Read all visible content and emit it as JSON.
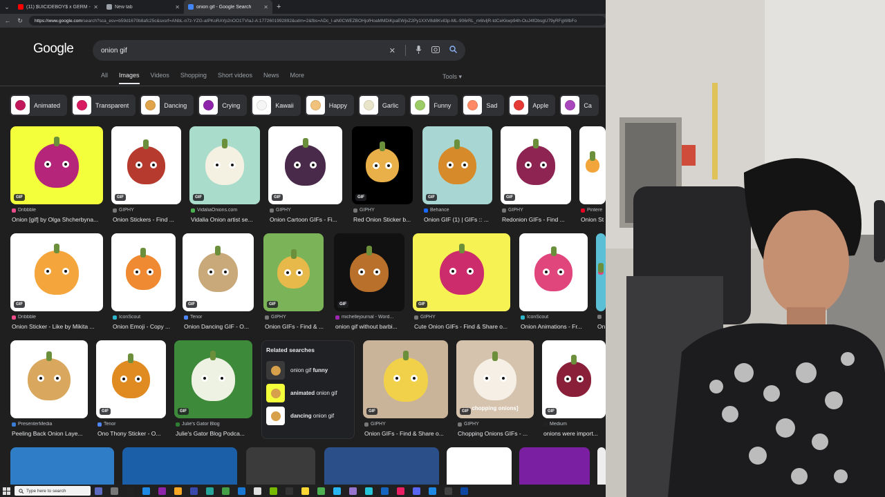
{
  "browser": {
    "tabs": [
      {
        "label": "(11) $UICIDEBOY$ x GERM - CENT",
        "favicon_color": "#ff0000",
        "active": false
      },
      {
        "label": "New tab",
        "favicon_color": "#9aa0a6",
        "active": false
      },
      {
        "label": "onion gif - Google Search",
        "favicon_color": "#4285f4",
        "active": true
      }
    ],
    "url_host": "https://www.google.com",
    "url_rest": "/search?sca_esv=b59d1670b8afc25c&sxsrf=ANbL-n7z-YZG-aIPKoRAYp2nOO1TVIaJ-A:1772601992892&udm=2&fbs=ADc_l-aN0CWEZBOHjofHoaMMDiKpaEWjvZ2Py1XXV8d8Kvil3p-ML-906rRL_m6lvljR-tdCeKkwp94h-OuJ4fObsgU79yRFgWlbFo"
  },
  "google": {
    "logo": "Google",
    "query": "onion gif",
    "tabs": [
      "All",
      "Images",
      "Videos",
      "Shopping",
      "Short videos",
      "News",
      "More"
    ],
    "active_tab": "Images",
    "tools": "Tools"
  },
  "chips": [
    {
      "label": "Animated",
      "color": "#c2185b"
    },
    {
      "label": "Transparent",
      "color": "#d81b60"
    },
    {
      "label": "Dancing",
      "color": "#e0a44a"
    },
    {
      "label": "Crying",
      "color": "#8e24aa"
    },
    {
      "label": "Kawaii",
      "color": "#f5f5f5"
    },
    {
      "label": "Happy",
      "color": "#f0c27b"
    },
    {
      "label": "Garlic",
      "color": "#e8e4c9"
    },
    {
      "label": "Funny",
      "color": "#9ccc65"
    },
    {
      "label": "Sad",
      "color": "#ff8a65"
    },
    {
      "label": "Apple",
      "color": "#e53935"
    },
    {
      "label": "Ca",
      "color": "#ab47bc"
    }
  ],
  "results": [
    {
      "source": "Dribbble",
      "title": "Onion [gif] by Olga Shcherbyna...",
      "gif": "GIF",
      "bg": "#f3ff3a",
      "onion": "#b5267a",
      "src_color": "#ea4c89"
    },
    {
      "source": "GIPHY",
      "title": "Onion Stickers - Find ...",
      "gif": "GIF",
      "bg": "#ffffff",
      "onion": "#b63a2e",
      "src_color": "#777777"
    },
    {
      "source": "VidaliaOnions.com",
      "title": "Vidalia Onion artist se...",
      "gif": "GIF",
      "bg": "#a9dccb",
      "onion": "#f4f1e2",
      "src_color": "#4caf50"
    },
    {
      "source": "GIPHY",
      "title": "Onion Cartoon GIFs - Fi...",
      "gif": "GIF",
      "bg": "#ffffff",
      "onion": "#4a2a4a",
      "src_color": "#777777"
    },
    {
      "source": "GIPHY",
      "title": "Red Onion Sticker b...",
      "gif": "GIF",
      "bg": "#000000",
      "onion": "#e9b049",
      "src_color": "#777777"
    },
    {
      "source": "Behance",
      "title": "Onion GIF (1) | GIFs :: ...",
      "gif": "GIF",
      "bg": "#a7d6d3",
      "onion": "#d68a2a",
      "src_color": "#1769ff"
    },
    {
      "source": "GIPHY",
      "title": "Redonion GIFs - Find ...",
      "gif": "GIF",
      "bg": "#ffffff",
      "onion": "#8e2452",
      "src_color": "#777777"
    },
    {
      "source": "Pintere",
      "title": "Onion St",
      "gif": "",
      "bg": "#ffffff",
      "onion": "#f2a53a",
      "src_color": "#e60023"
    },
    {
      "source": "Dribbble",
      "title": "Onion Sticker - Like by Mikita ...",
      "gif": "GIF",
      "bg": "#ffffff",
      "onion": "#f4a53c",
      "src_color": "#ea4c89"
    },
    {
      "source": "IconScout",
      "title": "Onion Emoji - Copy ...",
      "gif": "",
      "bg": "#ffffff",
      "onion": "#f08a32",
      "src_color": "#2eb5c9"
    },
    {
      "source": "Tenor",
      "title": "Onion Dancing GIF - O...",
      "gif": "GIF",
      "bg": "#ffffff",
      "onion": "#c9a97a",
      "src_color": "#4f86f7"
    },
    {
      "source": "GIPHY",
      "title": "Onion GIFs - Find & ...",
      "gif": "GIF",
      "bg": "#7bb458",
      "onion": "#e7b94a",
      "src_color": "#777777"
    },
    {
      "source": "michellejournal - Word...",
      "title": "onion gif without barbi...",
      "gif": "GIF",
      "bg": "#111111",
      "onion": "#b8702a",
      "src_color": "#9c27b0"
    },
    {
      "source": "GIPHY",
      "title": "Cute Onion GIFs - Find & Share o...",
      "gif": "GIF",
      "bg": "#f7f254",
      "onion": "#cc2c6b",
      "src_color": "#777777"
    },
    {
      "source": "IconScout",
      "title": "Onion Animations - Fr...",
      "gif": "",
      "bg": "#ffffff",
      "onion": "#e0457c",
      "src_color": "#2eb5c9"
    },
    {
      "source": "",
      "title": "On",
      "gif": "",
      "bg": "#5bbfd6",
      "onion": "#e0457c",
      "src_color": "#777777"
    },
    {
      "source": "PresenterMedia",
      "title": "Peeling Back Onion Laye...",
      "gif": "",
      "bg": "#ffffff",
      "onion": "#d9a85e",
      "src_color": "#3a7bd5"
    },
    {
      "source": "Tenor",
      "title": "Ono Thony Sticker - O...",
      "gif": "GIF",
      "bg": "#ffffff",
      "onion": "#e08b22",
      "src_color": "#4f86f7"
    },
    {
      "source": "Julie's Gator Blog",
      "title": "Julie's Gator Blog Podca...",
      "gif": "GIF",
      "bg": "#3d8a3a",
      "onion": "#eef2e2",
      "src_color": "#2e7d32"
    },
    {
      "source": "GIPHY",
      "title": "Onion GIFs - Find & Share o...",
      "gif": "GIF",
      "bg": "#c9b49a",
      "onion": "#f2d14a",
      "src_color": "#777777"
    },
    {
      "source": "GIPHY",
      "title": "Chopping Onions GIFs - ...",
      "gif": "GIF",
      "bg": "#d6c3ad",
      "onion": "#f5efe6",
      "src_color": "#777777",
      "caption": "chopping onions]"
    },
    {
      "source": "Medium",
      "title": "onions were import...",
      "gif": "GIF",
      "bg": "#ffffff",
      "onion": "#8a1f3a",
      "src_color": "#222222"
    }
  ],
  "related": {
    "heading": "Related searches",
    "items": [
      {
        "prefix": "onion gif ",
        "bold": "funny",
        "thumb": "#3a3a3a"
      },
      {
        "prefix": "",
        "bold": "animated",
        "suffix": " onion gif",
        "thumb": "#f3ff3a"
      },
      {
        "prefix": "",
        "bold": "dancing",
        "suffix": " onion gif",
        "thumb": "#ffffff"
      }
    ]
  },
  "bottom_row_colors": [
    "#2f7dc7",
    "#1b5fa8",
    "#3b3b3b",
    "#2b4f88",
    "#ffffff",
    "#7b1fa2",
    "#eeeeee"
  ],
  "taskbar": {
    "search_placeholder": "Type here to search",
    "icon_colors": [
      "#5c6bc0",
      "#777",
      "#222",
      "#1e88e5",
      "#8e24aa",
      "#f9a825",
      "#3949ab",
      "#26a69a",
      "#43a047",
      "#1976d2",
      "#e0e0e0",
      "#76b900",
      "#333",
      "#fdd835",
      "#4caf50",
      "#29b6f6",
      "#9575cd",
      "#26c6da",
      "#1565c0",
      "#e91e63",
      "#5865f2",
      "#1e88e5",
      "#424242",
      "#0d47a1"
    ]
  }
}
